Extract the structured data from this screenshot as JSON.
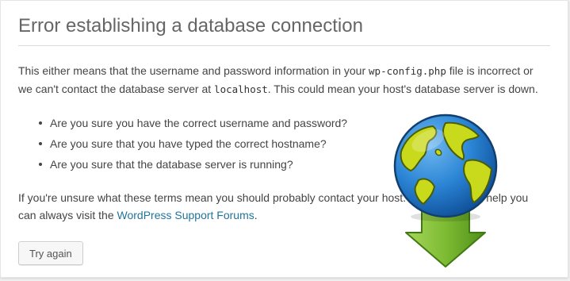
{
  "title": "Error establishing a database connection",
  "intro": {
    "part1": "This either means that the username and password information in your ",
    "code1": "wp-config.php",
    "part2": " file is incorrect or we can't contact the database server at ",
    "code2": "localhost",
    "part3": ". This could mean your host's database server is down."
  },
  "checklist": [
    "Are you sure you have the correct username and password?",
    "Are you sure that you have typed the correct hostname?",
    "Are you sure that the database server is running?"
  ],
  "outro": {
    "part1": "If you're unsure what these terms mean you should probably contact your host. If you still need help you can always visit the ",
    "link": "WordPress Support Forums",
    "part2": "."
  },
  "button": {
    "label": "Try again"
  },
  "overlay": {
    "icon": "globe-download-icon",
    "colors": {
      "ocean": "#1f79c9",
      "land": "#c8d81a",
      "arrow": "#79b82e"
    }
  }
}
